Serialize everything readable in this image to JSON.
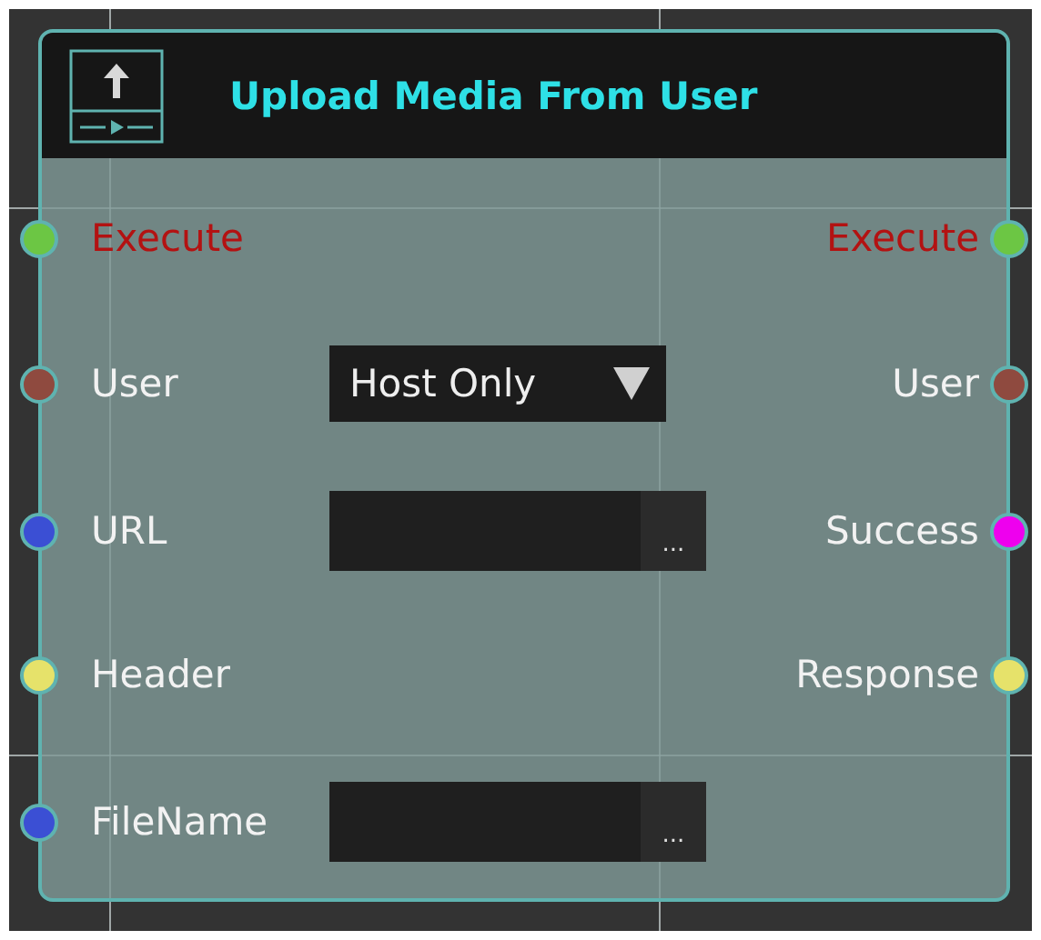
{
  "node": {
    "title": "Upload Media From User",
    "rows": [
      {
        "left": {
          "label": "Execute",
          "kind": "exec",
          "color": "#6cc644"
        },
        "right": {
          "label": "Execute",
          "kind": "exec",
          "color": "#6cc644"
        }
      },
      {
        "left": {
          "label": "User",
          "kind": "data",
          "color": "#8f4a3f"
        },
        "control": {
          "kind": "dropdown",
          "value": "Host Only"
        },
        "right": {
          "label": "User",
          "kind": "data",
          "color": "#8f4a3f"
        }
      },
      {
        "left": {
          "label": "URL",
          "kind": "data",
          "color": "#3b4fd4"
        },
        "control": {
          "kind": "text",
          "button": "..."
        },
        "right": {
          "label": "Success",
          "kind": "data",
          "color": "#ee00ee"
        }
      },
      {
        "left": {
          "label": "Header",
          "kind": "data",
          "color": "#e6e26a"
        },
        "right": {
          "label": "Response",
          "kind": "data",
          "color": "#e6e26a"
        }
      },
      {
        "left": {
          "label": "FileName",
          "kind": "data",
          "color": "#3b4fd4"
        },
        "control": {
          "kind": "text",
          "button": "..."
        }
      }
    ]
  }
}
